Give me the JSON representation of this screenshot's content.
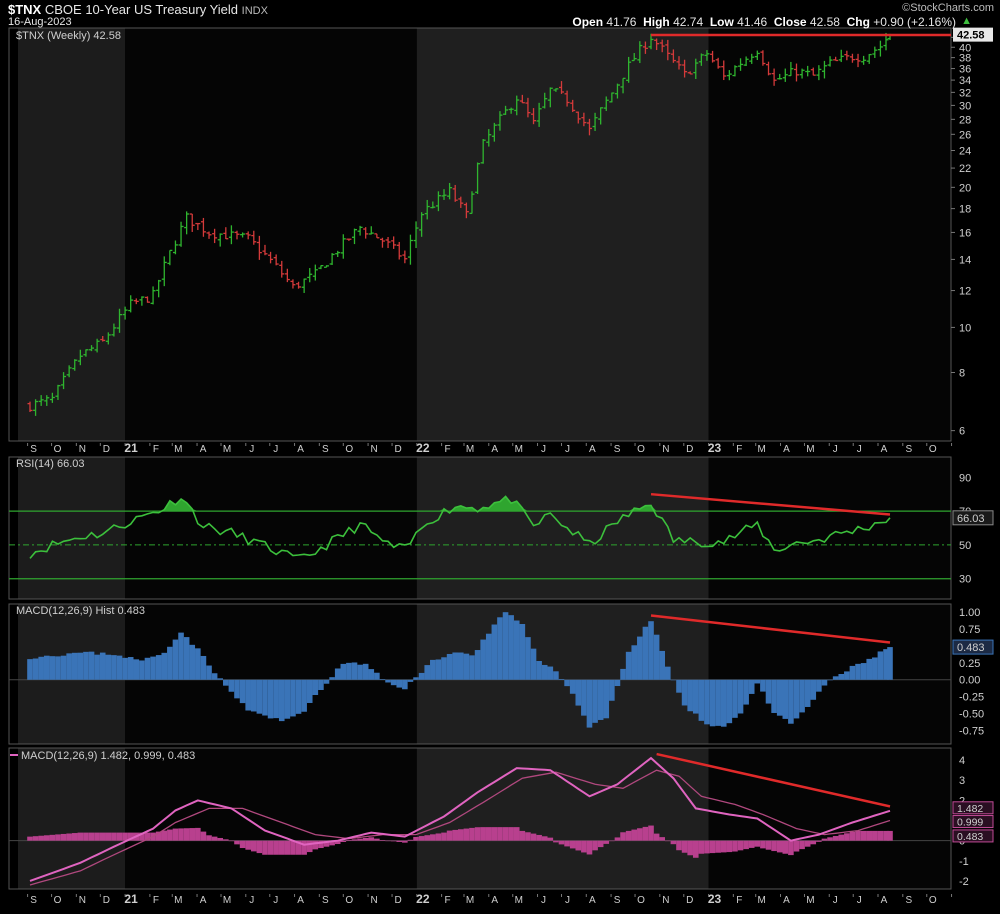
{
  "header": {
    "symbol": "$TNX",
    "name": "CBOE 10-Year US Treasury Yield",
    "exchange": "INDX",
    "date": "16-Aug-2023",
    "watermark": "©StockCharts.com",
    "open_label": "Open",
    "open": "41.76",
    "high_label": "High",
    "high": "42.74",
    "low_label": "Low",
    "low": "41.46",
    "close_label": "Close",
    "close": "42.58",
    "chg_label": "Chg",
    "chg": "+0.90 (+2.16%)",
    "chg_arrow": "▲"
  },
  "colors": {
    "up": "#2fb52f",
    "down": "#d43a3a",
    "band_dark": "#000000",
    "band_light": "#1c1c1c",
    "rsi_line": "#3cc03c",
    "hist": "#3a74b8",
    "macd_line": "#e064c0",
    "signal_line": "#b0487e",
    "macd_hist": "#b8408e",
    "trend": "#e02a2a",
    "grid": "#2a2a2a",
    "axis_text": "#cfcfcf"
  },
  "chart_data": [
    {
      "type": "ohlc",
      "legend": "$TNX (Weekly) 42.58",
      "last_value_label": "42.58",
      "scale": "log",
      "ylim": [
        5.7,
        44
      ],
      "y_ticks": [
        6,
        8,
        10,
        12,
        14,
        16,
        18,
        20,
        22,
        24,
        26,
        28,
        30,
        32,
        34,
        36,
        38,
        40,
        42
      ],
      "x_labels": [
        "S",
        "O",
        "N",
        "D",
        "21",
        "F",
        "M",
        "A",
        "M",
        "J",
        "J",
        "A",
        "S",
        "O",
        "N",
        "D",
        "22",
        "F",
        "M",
        "A",
        "M",
        "J",
        "J",
        "A",
        "S",
        "O",
        "N",
        "D",
        "23",
        "F",
        "M",
        "A",
        "M",
        "J",
        "J",
        "A",
        "S",
        "O"
      ],
      "weekly_close_anchors": [
        [
          "2020-09-04",
          6.8
        ],
        [
          "2020-10-02",
          7.0
        ],
        [
          "2020-11-06",
          8.7
        ],
        [
          "2020-12-04",
          9.3
        ],
        [
          "2021-01-08",
          11.2
        ],
        [
          "2021-02-05",
          11.7
        ],
        [
          "2021-03-19",
          17.2
        ],
        [
          "2021-04-16",
          16.0
        ],
        [
          "2021-05-07",
          15.8
        ],
        [
          "2021-06-04",
          15.5
        ],
        [
          "2021-07-09",
          13.5
        ],
        [
          "2021-07-30",
          12.2
        ],
        [
          "2021-08-27",
          13.0
        ],
        [
          "2021-10-22",
          16.4
        ],
        [
          "2021-11-19",
          15.4
        ],
        [
          "2021-12-17",
          14.0
        ],
        [
          "2022-01-07",
          17.6
        ],
        [
          "2022-02-11",
          19.6
        ],
        [
          "2022-03-04",
          17.4
        ],
        [
          "2022-03-25",
          24.7
        ],
        [
          "2022-05-06",
          31.2
        ],
        [
          "2022-05-27",
          27.4
        ],
        [
          "2022-06-17",
          32.3
        ],
        [
          "2022-07-08",
          30.9
        ],
        [
          "2022-08-05",
          26.5
        ],
        [
          "2022-09-02",
          31.9
        ],
        [
          "2022-09-30",
          38.0
        ],
        [
          "2022-10-21",
          42.1
        ],
        [
          "2022-11-11",
          38.2
        ],
        [
          "2022-12-02",
          34.9
        ],
        [
          "2022-12-30",
          38.8
        ],
        [
          "2023-01-20",
          34.5
        ],
        [
          "2023-03-03",
          39.6
        ],
        [
          "2023-03-24",
          33.8
        ],
        [
          "2023-04-21",
          35.6
        ],
        [
          "2023-05-12",
          34.7
        ],
        [
          "2023-06-02",
          36.9
        ],
        [
          "2023-06-30",
          38.2
        ],
        [
          "2023-07-14",
          38.3
        ],
        [
          "2023-08-04",
          40.2
        ],
        [
          "2023-08-16",
          42.58
        ]
      ],
      "resistance_line": {
        "from": [
          "2022-10-21",
          42.5
        ],
        "to": [
          "2023-08-16",
          42.5
        ]
      }
    },
    {
      "type": "line",
      "legend": "RSI(14) 66.03",
      "last_value_label": "66.03",
      "ylim": [
        18,
        102
      ],
      "y_ticks": [
        30,
        50,
        70,
        90
      ],
      "levels": [
        30,
        50,
        70
      ],
      "anchors": [
        [
          "2020-09-04",
          45
        ],
        [
          "2020-10-02",
          50
        ],
        [
          "2020-11-06",
          55
        ],
        [
          "2020-12-04",
          57
        ],
        [
          "2021-01-08",
          64
        ],
        [
          "2021-02-19",
          72
        ],
        [
          "2021-03-12",
          79
        ],
        [
          "2021-04-09",
          61
        ],
        [
          "2021-05-14",
          57
        ],
        [
          "2021-06-11",
          52
        ],
        [
          "2021-07-16",
          45
        ],
        [
          "2021-08-06",
          41
        ],
        [
          "2021-08-27",
          46
        ],
        [
          "2021-10-22",
          62
        ],
        [
          "2021-11-26",
          50
        ],
        [
          "2021-12-17",
          47
        ],
        [
          "2022-01-14",
          64
        ],
        [
          "2022-02-18",
          73
        ],
        [
          "2022-03-18",
          72
        ],
        [
          "2022-04-29",
          77
        ],
        [
          "2022-05-27",
          61
        ],
        [
          "2022-06-17",
          68
        ],
        [
          "2022-07-08",
          60
        ],
        [
          "2022-08-05",
          50
        ],
        [
          "2022-09-09",
          64
        ],
        [
          "2022-10-21",
          75
        ],
        [
          "2022-11-18",
          53
        ],
        [
          "2022-12-09",
          52
        ],
        [
          "2023-01-20",
          52
        ],
        [
          "2023-03-03",
          62
        ],
        [
          "2023-03-24",
          47
        ],
        [
          "2023-04-21",
          51
        ],
        [
          "2023-05-19",
          53
        ],
        [
          "2023-06-16",
          57
        ],
        [
          "2023-07-14",
          60
        ],
        [
          "2023-08-16",
          66.03
        ]
      ],
      "divergence_line": {
        "from": [
          "2022-10-21",
          80
        ],
        "to": [
          "2023-08-16",
          68
        ]
      }
    },
    {
      "type": "bar",
      "legend": "MACD(12,26,9) Hist 0.483",
      "last_value_label": "0.483",
      "ylim": [
        -0.95,
        1.12
      ],
      "y_ticks": [
        -0.75,
        -0.5,
        -0.25,
        0.0,
        0.25,
        0.5,
        0.75,
        1.0
      ],
      "tick_labels": [
        "-0.75",
        "-0.50",
        "-0.25",
        "0.00",
        "0.25",
        "0.50",
        "0.75",
        "1.00"
      ],
      "anchors": [
        [
          "2020-09-04",
          0.33
        ],
        [
          "2020-11-06",
          0.4
        ],
        [
          "2020-12-18",
          0.38
        ],
        [
          "2021-01-22",
          0.28
        ],
        [
          "2021-02-19",
          0.4
        ],
        [
          "2021-03-12",
          0.72
        ],
        [
          "2021-04-09",
          0.35
        ],
        [
          "2021-04-30",
          0.0
        ],
        [
          "2021-06-04",
          -0.45
        ],
        [
          "2021-07-16",
          -0.62
        ],
        [
          "2021-08-13",
          -0.45
        ],
        [
          "2021-09-10",
          -0.05
        ],
        [
          "2021-10-01",
          0.25
        ],
        [
          "2021-10-29",
          0.22
        ],
        [
          "2021-11-26",
          -0.05
        ],
        [
          "2021-12-17",
          -0.12
        ],
        [
          "2022-01-07",
          0.1
        ],
        [
          "2022-01-21",
          0.3
        ],
        [
          "2022-02-25",
          0.42
        ],
        [
          "2022-03-11",
          0.35
        ],
        [
          "2022-04-08",
          0.8
        ],
        [
          "2022-04-22",
          1.0
        ],
        [
          "2022-05-13",
          0.8
        ],
        [
          "2022-06-03",
          0.3
        ],
        [
          "2022-06-24",
          0.12
        ],
        [
          "2022-07-15",
          -0.2
        ],
        [
          "2022-08-05",
          -0.7
        ],
        [
          "2022-08-26",
          -0.55
        ],
        [
          "2022-09-23",
          0.4
        ],
        [
          "2022-10-21",
          0.88
        ],
        [
          "2022-11-11",
          0.2
        ],
        [
          "2022-12-02",
          -0.4
        ],
        [
          "2022-12-30",
          -0.65
        ],
        [
          "2023-01-20",
          -0.7
        ],
        [
          "2023-02-10",
          -0.5
        ],
        [
          "2023-03-03",
          -0.05
        ],
        [
          "2023-03-24",
          -0.5
        ],
        [
          "2023-04-14",
          -0.65
        ],
        [
          "2023-05-05",
          -0.4
        ],
        [
          "2023-06-02",
          0.0
        ],
        [
          "2023-06-30",
          0.18
        ],
        [
          "2023-07-21",
          0.3
        ],
        [
          "2023-08-16",
          0.483
        ]
      ],
      "divergence_line": {
        "from": [
          "2022-10-21",
          0.95
        ],
        "to": [
          "2023-08-16",
          0.55
        ]
      }
    },
    {
      "type": "line",
      "legend": "MACD(12,26,9) 1.482, 0.999, 0.483",
      "last_value_labels": [
        "1.482",
        "0.999",
        "0.483"
      ],
      "ylim": [
        -2.4,
        4.6
      ],
      "y_ticks": [
        -2,
        -1,
        0,
        1,
        2,
        3,
        4
      ],
      "macd_anchors": [
        [
          "2020-09-04",
          -2.0
        ],
        [
          "2020-11-06",
          -1.1
        ],
        [
          "2020-12-18",
          -0.3
        ],
        [
          "2021-02-05",
          0.6
        ],
        [
          "2021-03-05",
          1.5
        ],
        [
          "2021-04-02",
          2.0
        ],
        [
          "2021-05-14",
          1.6
        ],
        [
          "2021-06-25",
          0.5
        ],
        [
          "2021-08-13",
          -0.2
        ],
        [
          "2021-09-24",
          0.0
        ],
        [
          "2021-11-05",
          0.4
        ],
        [
          "2021-12-17",
          0.2
        ],
        [
          "2022-02-04",
          1.2
        ],
        [
          "2022-03-18",
          2.4
        ],
        [
          "2022-05-06",
          3.6
        ],
        [
          "2022-06-17",
          3.5
        ],
        [
          "2022-08-05",
          2.2
        ],
        [
          "2022-09-09",
          2.8
        ],
        [
          "2022-10-21",
          4.1
        ],
        [
          "2022-11-18",
          3.1
        ],
        [
          "2022-12-16",
          1.6
        ],
        [
          "2023-01-27",
          1.3
        ],
        [
          "2023-03-03",
          1.1
        ],
        [
          "2023-04-14",
          0.0
        ],
        [
          "2023-05-19",
          0.3
        ],
        [
          "2023-06-30",
          0.9
        ],
        [
          "2023-08-16",
          1.482
        ]
      ],
      "signal_anchors": [
        [
          "2020-09-04",
          -2.2
        ],
        [
          "2020-11-06",
          -1.5
        ],
        [
          "2020-12-18",
          -0.7
        ],
        [
          "2021-02-05",
          0.2
        ],
        [
          "2021-03-05",
          0.9
        ],
        [
          "2021-04-16",
          1.6
        ],
        [
          "2021-05-28",
          1.6
        ],
        [
          "2021-07-09",
          1.0
        ],
        [
          "2021-08-27",
          0.3
        ],
        [
          "2021-10-08",
          0.1
        ],
        [
          "2021-11-19",
          0.3
        ],
        [
          "2021-12-31",
          0.3
        ],
        [
          "2022-02-11",
          0.9
        ],
        [
          "2022-03-25",
          1.9
        ],
        [
          "2022-05-13",
          3.1
        ],
        [
          "2022-06-24",
          3.4
        ],
        [
          "2022-08-12",
          2.8
        ],
        [
          "2022-09-16",
          2.6
        ],
        [
          "2022-10-28",
          3.5
        ],
        [
          "2022-11-25",
          3.2
        ],
        [
          "2022-12-23",
          2.2
        ],
        [
          "2023-02-03",
          1.8
        ],
        [
          "2023-03-10",
          1.3
        ],
        [
          "2023-04-21",
          0.6
        ],
        [
          "2023-05-26",
          0.3
        ],
        [
          "2023-07-07",
          0.5
        ],
        [
          "2023-08-16",
          0.999
        ]
      ],
      "histogram": "macd minus signal",
      "divergence_line": {
        "from": [
          "2022-10-28",
          4.3
        ],
        "to": [
          "2023-08-16",
          1.7
        ]
      }
    }
  ]
}
